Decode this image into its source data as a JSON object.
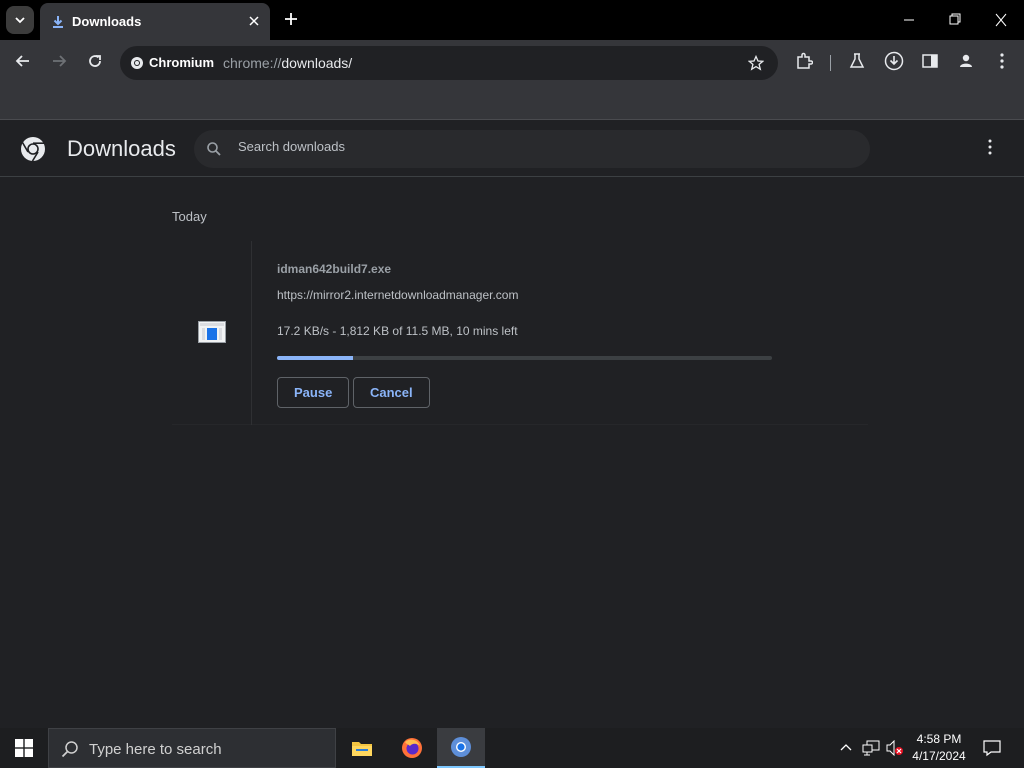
{
  "browser": {
    "tab": {
      "title": "Downloads"
    },
    "omnibox": {
      "chip_label": "Chromium",
      "url_scheme": "chrome://",
      "url_rest": "downloads/"
    }
  },
  "downloads_page": {
    "title": "Downloads",
    "search_placeholder": "Search downloads",
    "section_label": "Today",
    "items": [
      {
        "file_name": "idman642build7.exe",
        "url": "https://mirror2.internetdownloadmanager.com",
        "status": "17.2 KB/s - 1,812 KB of 11.5 MB, 10 mins left",
        "progress_percent": 15.4,
        "pause_label": "Pause",
        "cancel_label": "Cancel"
      }
    ]
  },
  "taskbar": {
    "search_placeholder": "Type here to search",
    "apps": [
      "file-explorer",
      "firefox",
      "chromium"
    ],
    "clock_time": "4:58 PM",
    "clock_date": "4/17/2024"
  },
  "colors": {
    "accent": "#8ab4f8",
    "page_bg": "#202124",
    "toolbar_bg": "#35363a",
    "tabstrip_bg": "#000000"
  }
}
